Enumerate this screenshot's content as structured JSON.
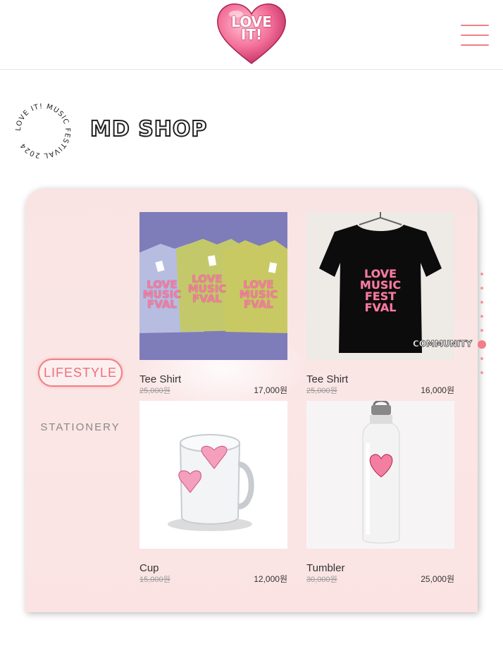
{
  "header": {
    "logo_text_line1": "LOVE",
    "logo_text_line2": "IT!",
    "logo_icon": "heart-logo",
    "menu_icon": "hamburger-icon"
  },
  "badge": {
    "circle_text": "LOVE IT! MUSIC FESTIVAL 2024"
  },
  "page": {
    "title": "MD SHOP"
  },
  "categories": [
    {
      "label": "LIFESTYLE",
      "active": true
    },
    {
      "label": "STATIONERY",
      "active": false
    }
  ],
  "products": [
    {
      "name": "Tee Shirt",
      "original_price": "25,000원",
      "price": "17,000원",
      "image": "three colored tee shirts with LOVE MUSIC FESTIVAL print"
    },
    {
      "name": "Tee Shirt",
      "original_price": "25,000원",
      "price": "16,000원",
      "image": "black tee shirt on hanger with LOVE MUSIC FESTIVAL print"
    },
    {
      "name": "Cup",
      "original_price": "15,000원",
      "price": "12,000원",
      "image": "glass mug with pink heart stickers"
    },
    {
      "name": "Tumbler",
      "original_price": "30,000원",
      "price": "25,000원",
      "image": "white tumbler with pink LOVE IT heart"
    }
  ],
  "side_nav": {
    "active_label": "COMMUNITY",
    "dot_count": 8,
    "active_index": 5
  },
  "colors": {
    "accent": "#f07f86",
    "card_bg": "#fbe4e4",
    "brand_pink": "#f27ea0"
  }
}
